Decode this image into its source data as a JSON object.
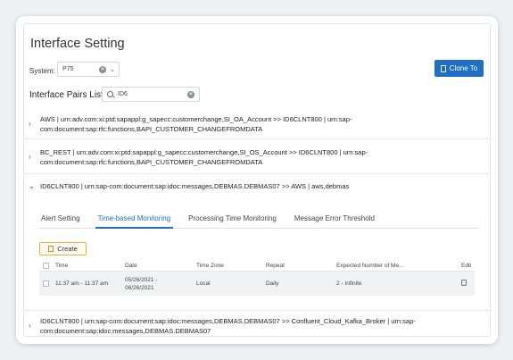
{
  "header": {
    "title": "Interface Setting"
  },
  "system": {
    "label": "System:",
    "value": "P75"
  },
  "actions": {
    "clone_label": "Clone To"
  },
  "pairs": {
    "title": "Interface Pairs List",
    "search_value": "ID6",
    "items": [
      {
        "line1": "AWS | urn:adv.com:xi:ptd:sapappl:g_sapecc:customerchange,SI_OA_Account >> ID6CLNT800 | urn:sap-",
        "line2": "com:document:sap:rfc:functions,BAPI_CUSTOMER_CHANGEFROMDATA"
      },
      {
        "line1": "BC_REST | urn:adv.com:xi:ptd:sapappl:g_sapecc:customerchange,SI_OS_Account >> ID6CLNT800 | urn:sap-",
        "line2": "com:document:sap:rfc:functions,BAPI_CUSTOMER_CHANGEFROMDATA"
      },
      {
        "line1": "ID6CLNT800 | urn:sap-com:document:sap:idoc:messages,DEBMAS.DEBMAS07 >> AWS | aws,debmas"
      },
      {
        "line1": "ID6CLNT800 | urn:sap-com:document:sap:idoc:messages,DEBMAS.DEBMAS07 >> Confluent_Cloud_Kafka_Broker | urn:sap-",
        "line2": "com:document:sap:idoc:messages,DEBMAS.DEBMAS07"
      }
    ]
  },
  "tabs": [
    "Alert Setting",
    "Time-based Monitoring",
    "Processing Time Monitoring",
    "Message Error Threshold"
  ],
  "create_label": "Create",
  "table": {
    "headers": [
      "Time",
      "Date",
      "Time Zone",
      "Repeat",
      "Expected Number of Me...",
      "Edit"
    ],
    "row": {
      "time": "11:37 am - 11:37 am",
      "date_line1": "05/26/2021 -",
      "date_line2": "06/26/2021",
      "timezone": "Local",
      "repeat": "Daily",
      "expected": "2 - Infinite"
    }
  },
  "colors": {
    "accent": "#1f6fc5",
    "create_border": "#e3b146"
  }
}
